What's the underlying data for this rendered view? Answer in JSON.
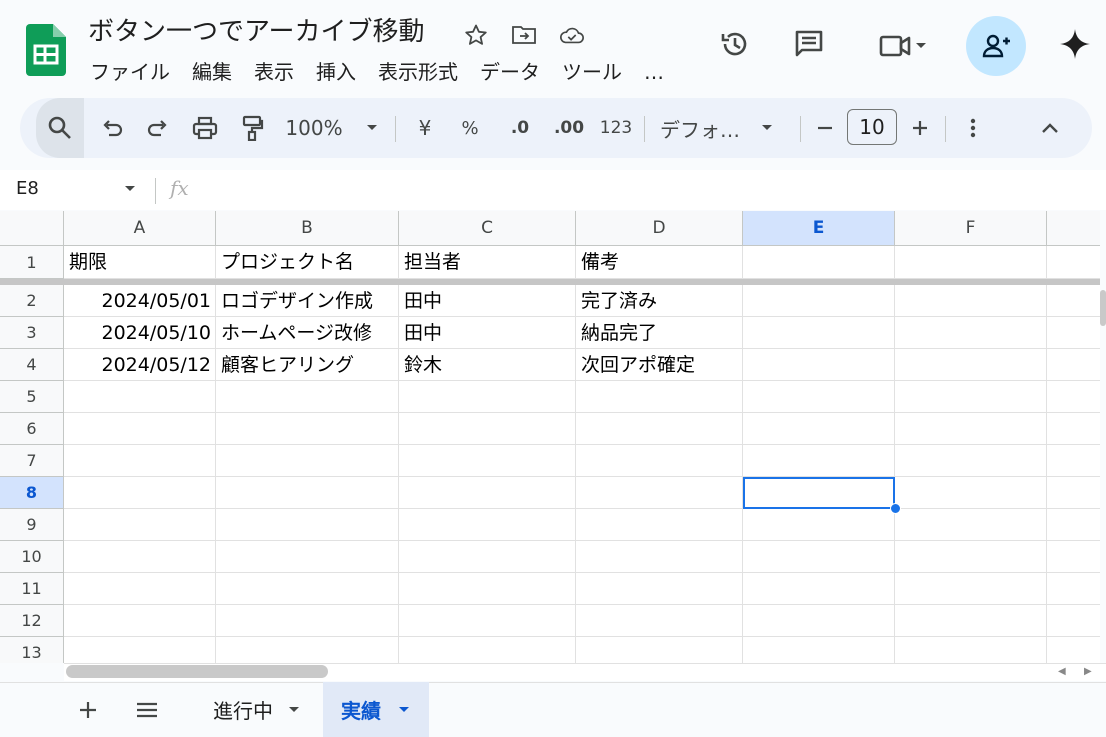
{
  "document": {
    "title": "ボタン一つでアーカイブ移動"
  },
  "menu": [
    "ファイル",
    "編集",
    "表示",
    "挿入",
    "表示形式",
    "データ",
    "ツール",
    "…"
  ],
  "toolbar": {
    "zoom": "100%",
    "currency": "¥",
    "percent": "%",
    "dec_decrease": ".0",
    "dec_increase": ".00",
    "number_format": "123",
    "font": "デフォ…",
    "font_size": "10"
  },
  "formula_bar": {
    "name_box": "E8",
    "fx": "fx",
    "value": ""
  },
  "grid": {
    "columns": [
      "A",
      "B",
      "C",
      "D",
      "E",
      "F"
    ],
    "selected_column": "E",
    "selected_row": "8",
    "rows": [
      {
        "n": "1",
        "cells": [
          "期限",
          "プロジェクト名",
          "担当者",
          "備考",
          "",
          ""
        ]
      },
      {
        "n": "2",
        "cells": [
          "2024/05/01",
          "ロゴデザイン作成",
          "田中",
          "完了済み",
          "",
          ""
        ]
      },
      {
        "n": "3",
        "cells": [
          "2024/05/10",
          "ホームページ改修",
          "田中",
          "納品完了",
          "",
          ""
        ]
      },
      {
        "n": "4",
        "cells": [
          "2024/05/12",
          "顧客ヒアリング",
          "鈴木",
          "次回アポ確定",
          "",
          ""
        ]
      },
      {
        "n": "5",
        "cells": [
          "",
          "",
          "",
          "",
          "",
          ""
        ]
      },
      {
        "n": "6",
        "cells": [
          "",
          "",
          "",
          "",
          "",
          ""
        ]
      },
      {
        "n": "7",
        "cells": [
          "",
          "",
          "",
          "",
          "",
          ""
        ]
      },
      {
        "n": "8",
        "cells": [
          "",
          "",
          "",
          "",
          "",
          ""
        ]
      },
      {
        "n": "9",
        "cells": [
          "",
          "",
          "",
          "",
          "",
          ""
        ]
      },
      {
        "n": "10",
        "cells": [
          "",
          "",
          "",
          "",
          "",
          ""
        ]
      },
      {
        "n": "11",
        "cells": [
          "",
          "",
          "",
          "",
          "",
          ""
        ]
      },
      {
        "n": "12",
        "cells": [
          "",
          "",
          "",
          "",
          "",
          ""
        ]
      },
      {
        "n": "13",
        "cells": [
          "",
          "",
          "",
          "",
          "",
          ""
        ]
      }
    ]
  },
  "sheets": [
    {
      "name": "進行中",
      "active": false
    },
    {
      "name": "実績",
      "active": true
    }
  ],
  "colors": {
    "accent": "#0b57d0",
    "selection": "#1a73e8",
    "sheets_green": "#0f9d58"
  }
}
